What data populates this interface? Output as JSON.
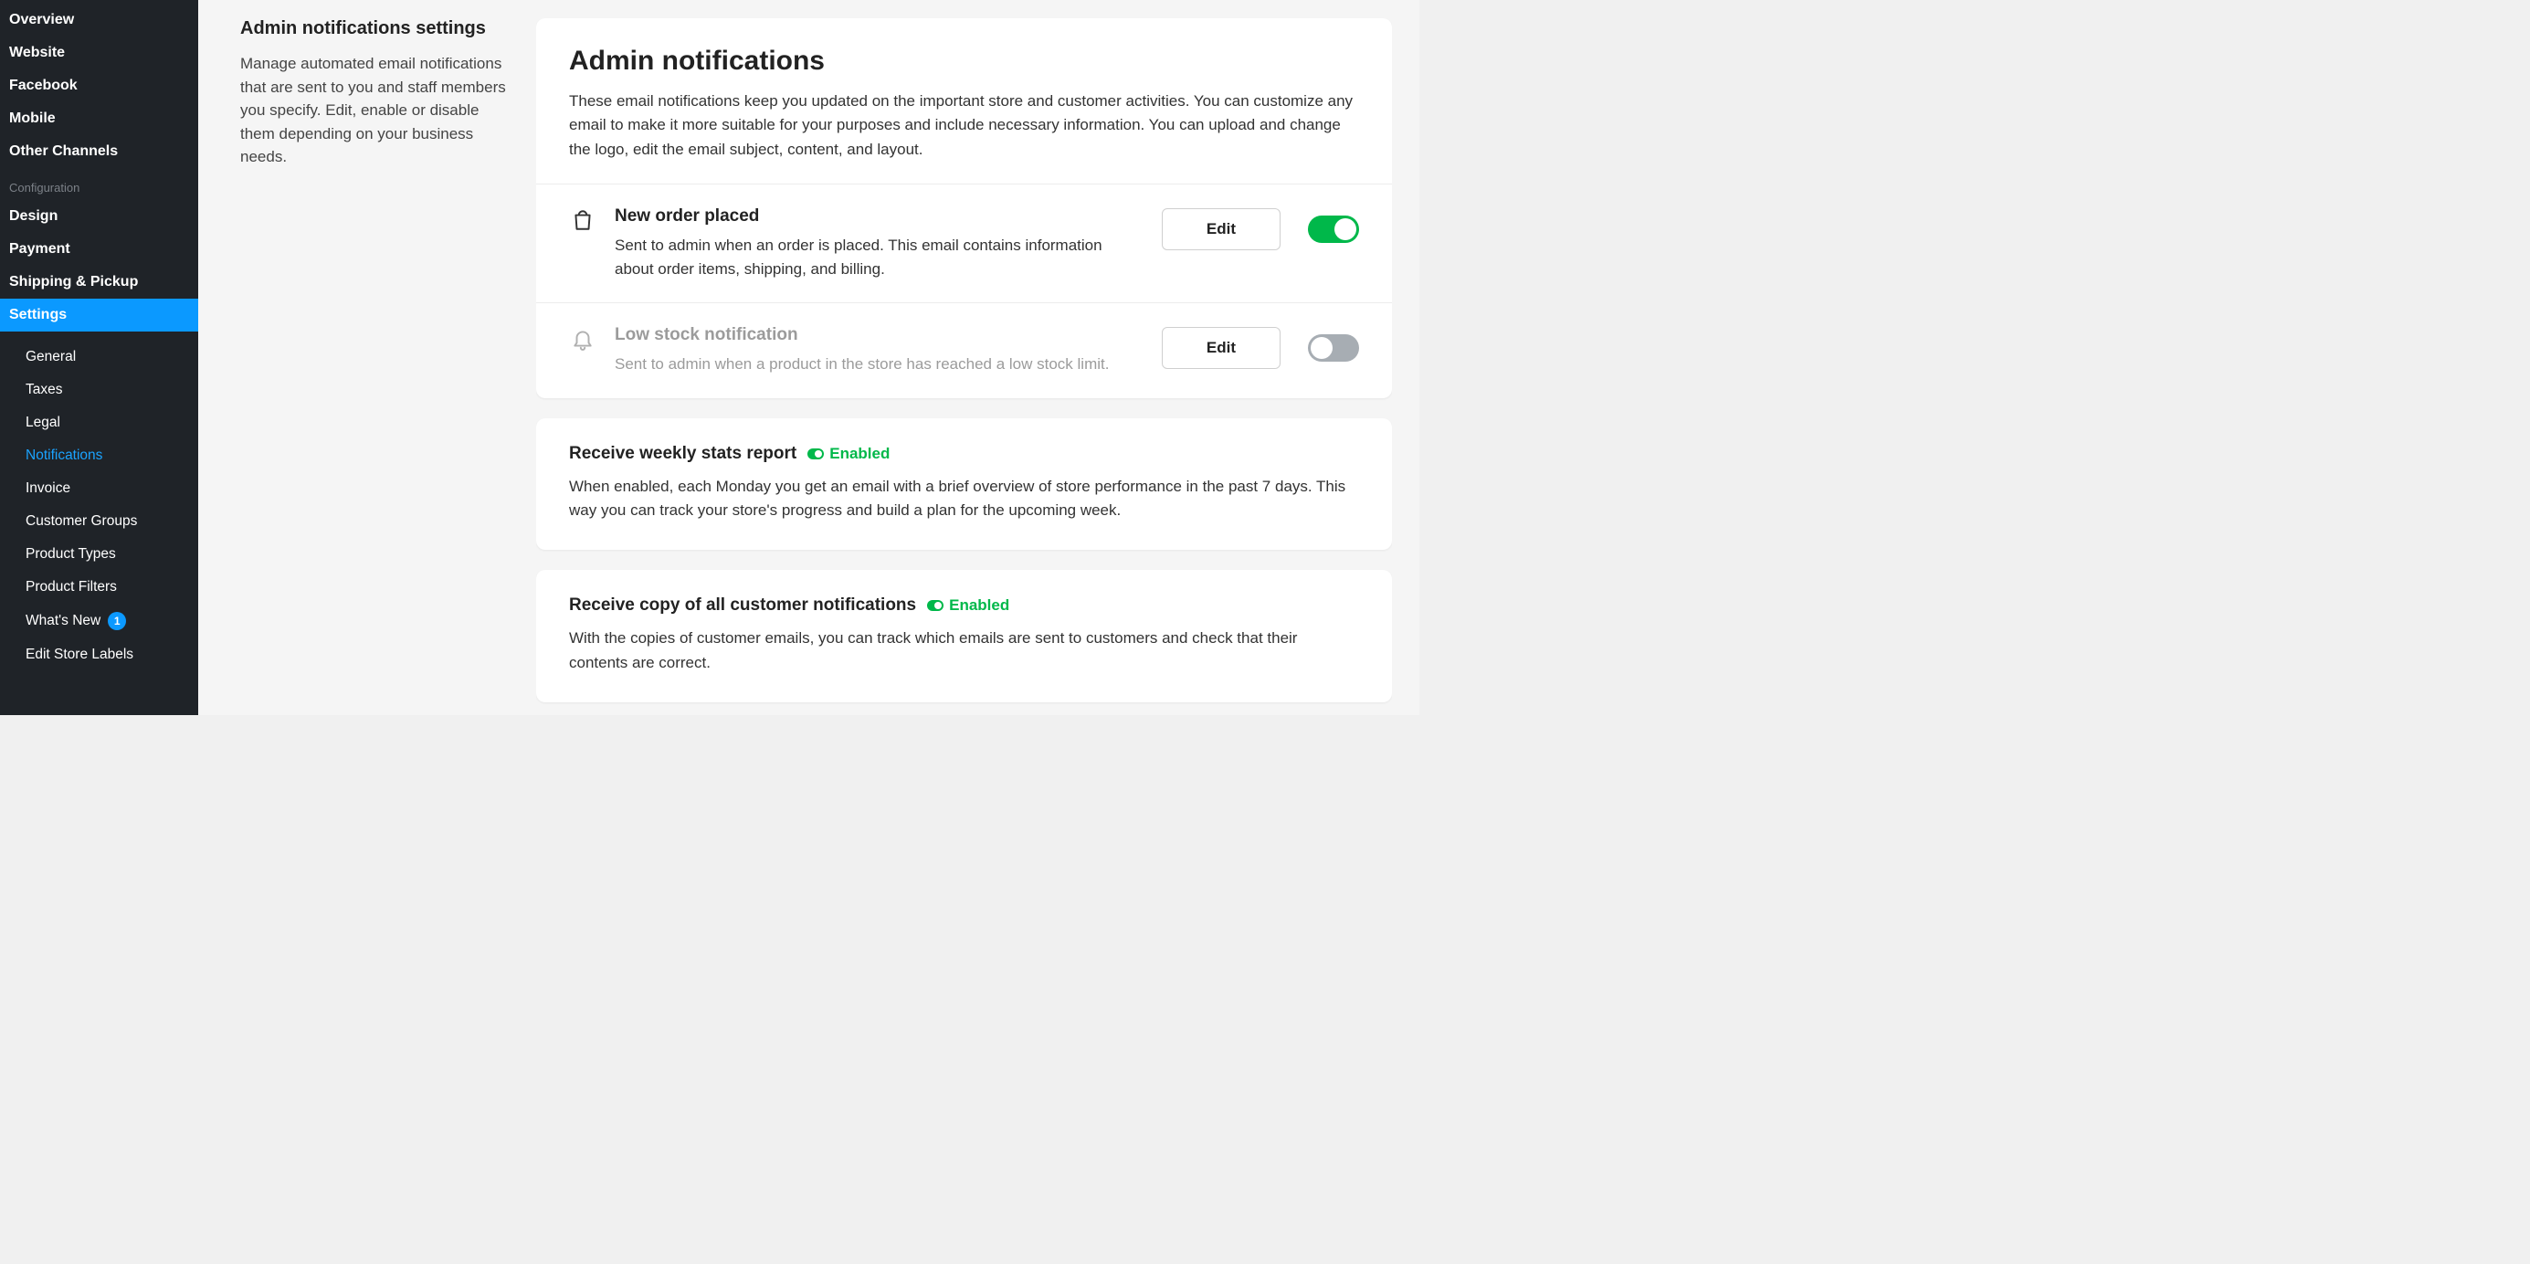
{
  "sidebar": {
    "channels": [
      {
        "label": "Overview"
      },
      {
        "label": "Website"
      },
      {
        "label": "Facebook"
      },
      {
        "label": "Mobile"
      },
      {
        "label": "Other Channels"
      }
    ],
    "config_heading": "Configuration",
    "config": [
      {
        "label": "Design"
      },
      {
        "label": "Payment"
      },
      {
        "label": "Shipping & Pickup"
      },
      {
        "label": "Settings"
      }
    ],
    "settings_sub": [
      {
        "label": "General"
      },
      {
        "label": "Taxes"
      },
      {
        "label": "Legal"
      },
      {
        "label": "Notifications"
      },
      {
        "label": "Invoice"
      },
      {
        "label": "Customer Groups"
      },
      {
        "label": "Product Types"
      },
      {
        "label": "Product Filters"
      },
      {
        "label": "What's New",
        "badge": "1"
      },
      {
        "label": "Edit Store Labels"
      }
    ]
  },
  "intro": {
    "title": "Admin notifications settings",
    "desc": "Manage automated email notifications that are sent to you and staff members you specify. Edit, enable or disable them depending on your business needs."
  },
  "card1": {
    "title": "Admin notifications",
    "desc": "These email notifications keep you updated on the important store and customer activities. You can customize any email to make it more suitable for your purposes and include necessary information. You can upload and change the logo, edit the email subject, content, and layout.",
    "rows": [
      {
        "title": "New order placed",
        "desc": "Sent to admin when an order is placed. This email contains information about order items, shipping, and billing.",
        "edit": "Edit"
      },
      {
        "title": "Low stock notification",
        "desc": "Sent to admin when a product in the store has reached a low stock limit.",
        "edit": "Edit"
      }
    ]
  },
  "section_weekly": {
    "title": "Receive weekly stats report",
    "status": "Enabled",
    "desc": "When enabled, each Monday you get an email with a brief overview of store performance in the past 7 days. This way you can track your store's progress and build a plan for the upcoming week."
  },
  "section_copies": {
    "title": "Receive copy of all customer notifications",
    "status": "Enabled",
    "desc": "With the copies of customer emails, you can track which emails are sent to customers and check that their contents are correct."
  }
}
